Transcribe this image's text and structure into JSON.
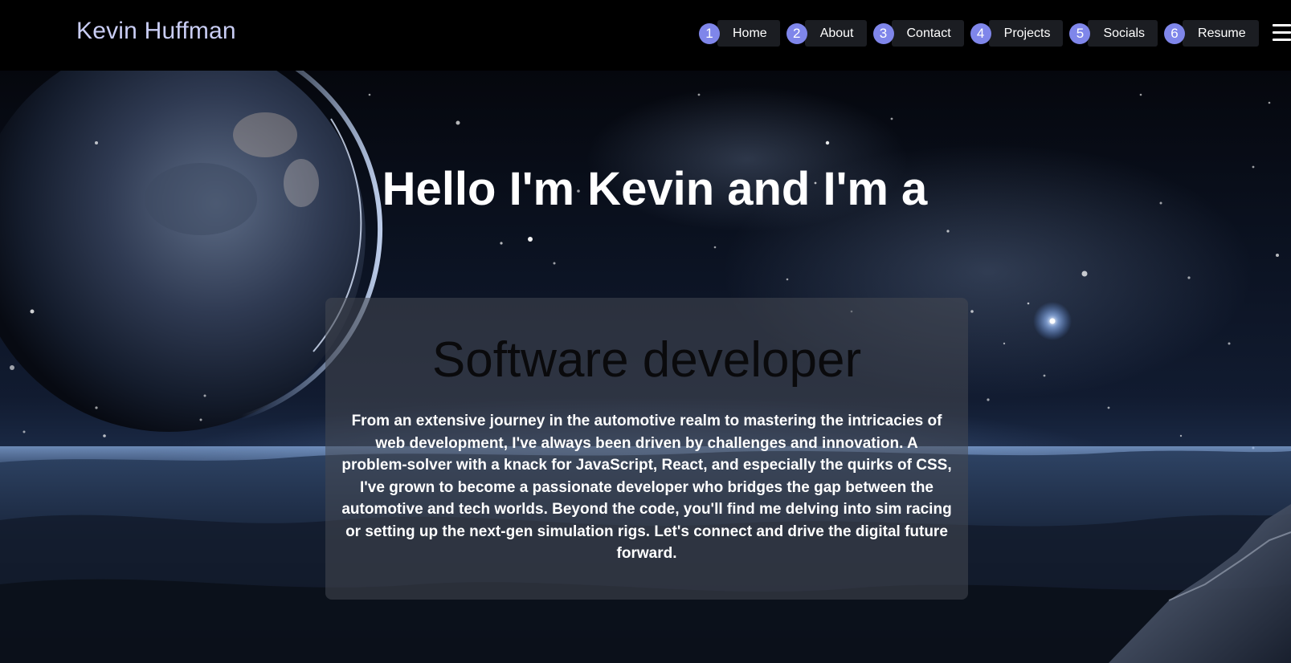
{
  "header": {
    "brand": "Kevin Huffman",
    "nav": [
      {
        "num": "1",
        "label": "Home"
      },
      {
        "num": "2",
        "label": "About"
      },
      {
        "num": "3",
        "label": "Contact"
      },
      {
        "num": "4",
        "label": "Projects"
      },
      {
        "num": "5",
        "label": "Socials"
      },
      {
        "num": "6",
        "label": "Resume"
      }
    ],
    "menu_icon": "hamburger-menu-icon"
  },
  "hero": {
    "headline": "Hello I'm Kevin and I'm a",
    "role": "Software developer",
    "bio": "From an extensive journey in the automotive realm to mastering the intricacies of web development, I've always been driven by challenges and innovation. A problem-solver with a knack for JavaScript, React, and especially the quirks of CSS, I've grown to become a passionate developer who bridges the gap between the automotive and tech worlds. Beyond the code, you'll find me delving into sim racing or setting up the next-gen simulation rigs. Let's connect and drive the digital future forward."
  },
  "colors": {
    "brand_text": "#c9cdf4",
    "nav_number_bg": "#7f86ea",
    "nav_button_bg": "#1b1d22",
    "header_bg": "#000000"
  }
}
